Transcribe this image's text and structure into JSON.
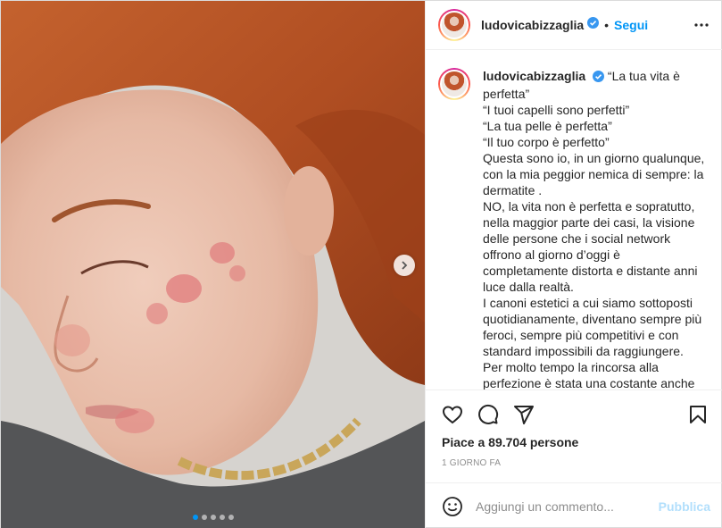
{
  "header": {
    "username": "ludovicabizzaglia",
    "separator": "•",
    "follow_label": "Segui"
  },
  "caption": {
    "username": "ludovicabizzaglia",
    "lines": [
      "“La tua vita è",
      "perfetta”",
      "“I tuoi capelli sono perfetti”",
      "“La tua pelle è perfetta”",
      "“Il tuo corpo è perfetto”",
      "Questa sono io, in un giorno qualunque,",
      "con la mia peggior nemica di sempre: la",
      "dermatite .",
      "NO, la vita non è perfetta e sopratutto,",
      "nella maggior parte dei casi, la visione",
      "delle persone che i social network",
      "offrono al giorno d’oggi è",
      "completamente distorta e distante anni",
      "luce dalla realtà.",
      "I canoni estetici a cui siamo sottoposti",
      "quotidianamente, diventano sempre più",
      "feroci, sempre più competitivi e con",
      "standard impossibili da raggiungere.",
      "Per molto tempo la rincorsa alla",
      "perfezione è stata una costante anche"
    ]
  },
  "likes": {
    "prefix": "Piace a ",
    "count": "89.704",
    "suffix": " persone"
  },
  "timestamp": "1 GIORNO FA",
  "comment": {
    "placeholder": "Aggiungi un commento...",
    "publish_label": "Pubblica"
  },
  "carousel": {
    "total": 5,
    "active_index": 0
  },
  "colors": {
    "accent": "#0095f6",
    "publish_disabled": "#b2dffc",
    "verified": "#3897f0"
  },
  "icons": [
    "verified-icon",
    "more-options-icon",
    "next-arrow-icon",
    "heart-icon",
    "comment-icon",
    "share-icon",
    "bookmark-icon",
    "emoji-icon"
  ]
}
